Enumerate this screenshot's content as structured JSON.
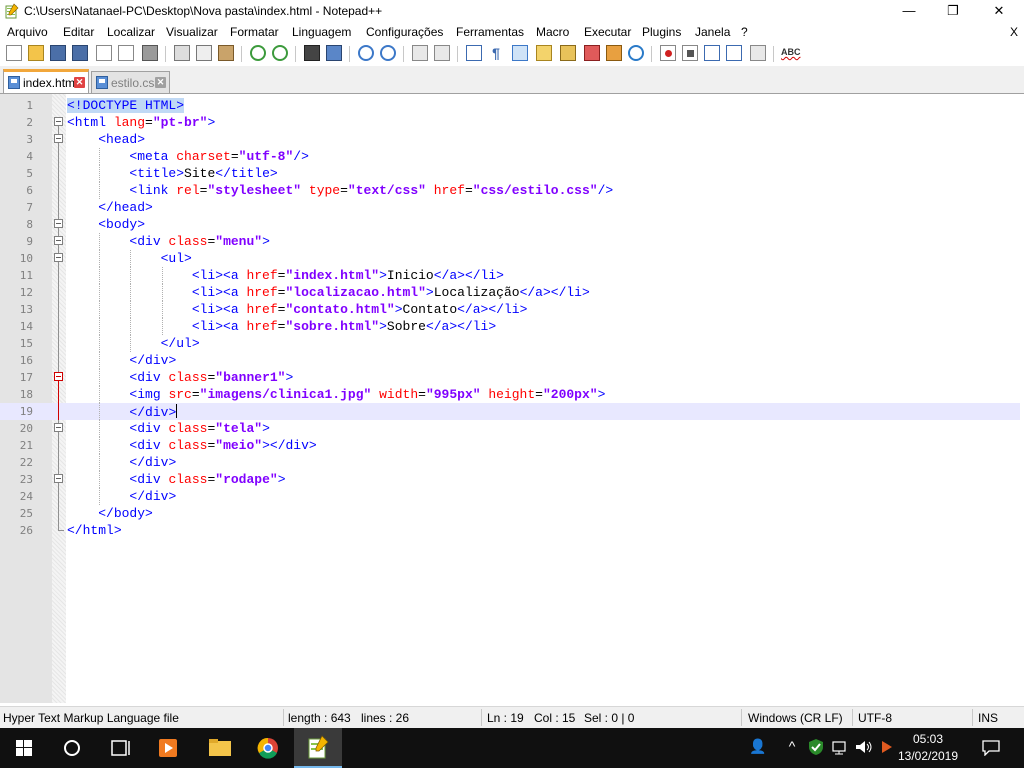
{
  "window": {
    "title": "C:\\Users\\Natanael-PC\\Desktop\\Nova pasta\\index.html - Notepad++",
    "minimize_glyph": "—",
    "maximize_glyph": "❐",
    "close_glyph": "✕"
  },
  "menu": {
    "items": [
      "Arquivo",
      "Editar",
      "Localizar",
      "Visualizar",
      "Formatar",
      "Linguagem",
      "Configurações",
      "Ferramentas",
      "Macro",
      "Executar",
      "Plugins",
      "Janela",
      "?"
    ],
    "close_doc": "X"
  },
  "toolbar": {
    "spellcheck_label": "ABC"
  },
  "tabs": [
    {
      "label": "index.html",
      "active": true
    },
    {
      "label": "estilo.css",
      "active": false
    }
  ],
  "editor": {
    "current_line": 19,
    "lines": [
      {
        "n": "1",
        "text": "<!DOCTYPE HTML>"
      },
      {
        "n": "2",
        "text": "<html lang=\"pt-br\">"
      },
      {
        "n": "3",
        "text": "    <head>"
      },
      {
        "n": "4",
        "text": "        <meta charset=\"utf-8\"/>"
      },
      {
        "n": "5",
        "text": "        <title>Site</title>"
      },
      {
        "n": "6",
        "text": "        <link rel=\"stylesheet\" type=\"text/css\" href=\"css/estilo.css\"/>"
      },
      {
        "n": "7",
        "text": "    </head>"
      },
      {
        "n": "8",
        "text": "    <body>"
      },
      {
        "n": "9",
        "text": "        <div class=\"menu\">"
      },
      {
        "n": "10",
        "text": "            <ul>"
      },
      {
        "n": "11",
        "text": "                <li><a href=\"index.html\">Inicio</a></li>"
      },
      {
        "n": "12",
        "text": "                <li><a href=\"localizacao.html\">Localização</a></li>"
      },
      {
        "n": "13",
        "text": "                <li><a href=\"contato.html\">Contato</a></li>"
      },
      {
        "n": "14",
        "text": "                <li><a href=\"sobre.html\">Sobre</a></li>"
      },
      {
        "n": "15",
        "text": "            </ul>"
      },
      {
        "n": "16",
        "text": "        </div>"
      },
      {
        "n": "17",
        "text": "        <div class=\"banner1\">"
      },
      {
        "n": "18",
        "text": "        <img src=\"imagens/clinica1.jpg\" width=\"995px\" height=\"200px\">"
      },
      {
        "n": "19",
        "text": "        </div>"
      },
      {
        "n": "20",
        "text": "        <div class=\"tela\">"
      },
      {
        "n": "21",
        "text": "        <div class=\"meio\"></div>"
      },
      {
        "n": "22",
        "text": "        </div>"
      },
      {
        "n": "23",
        "text": "        <div class=\"rodape\">"
      },
      {
        "n": "24",
        "text": "        </div>"
      },
      {
        "n": "25",
        "text": "    </body>"
      },
      {
        "n": "26",
        "text": "</html>"
      }
    ]
  },
  "status": {
    "file_type": "Hyper Text Markup Language file",
    "length": "length : 643",
    "lines": "lines : 26",
    "ln": "Ln : 19",
    "col": "Col : 15",
    "sel": "Sel : 0 | 0",
    "eol": "Windows (CR LF)",
    "encoding": "UTF-8",
    "mode": "INS"
  },
  "taskbar": {
    "time": "05:03",
    "date": "13/02/2019"
  }
}
